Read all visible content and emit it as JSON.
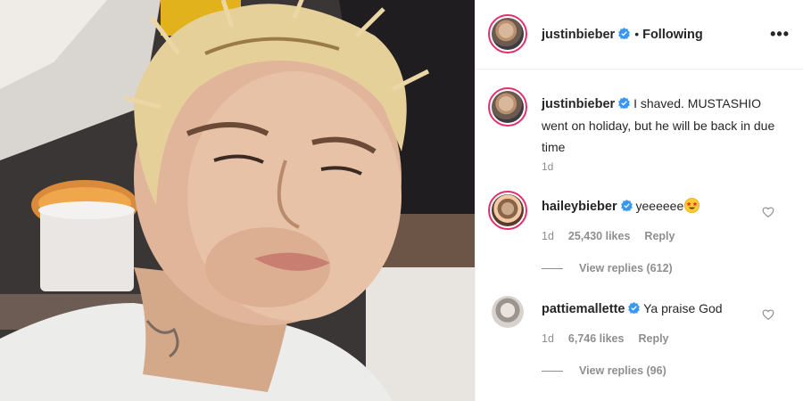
{
  "header": {
    "username": "justinbieber",
    "separator": "•",
    "follow_status": "Following",
    "more_icon": "more-options-icon",
    "more_label": "•••"
  },
  "caption": {
    "username": "justinbieber",
    "text": "I shaved. MUSTASHIO went on holiday, but he will be back in due time",
    "time": "1d"
  },
  "comments": [
    {
      "username": "haileybieber",
      "text": "yeeeeee",
      "emoji": "star-struck-emoji",
      "time": "1d",
      "likes": "25,430 likes",
      "reply_label": "Reply",
      "view_replies": "View replies (612)"
    },
    {
      "username": "pattiemallette",
      "text": "Ya praise God",
      "time": "1d",
      "likes": "6,746 likes",
      "reply_label": "Reply",
      "view_replies": "View replies (96)"
    }
  ],
  "colors": {
    "verified": "#3897f0",
    "muted": "#8e8e8e",
    "text": "#262626",
    "story_ring": "#e1306c"
  }
}
